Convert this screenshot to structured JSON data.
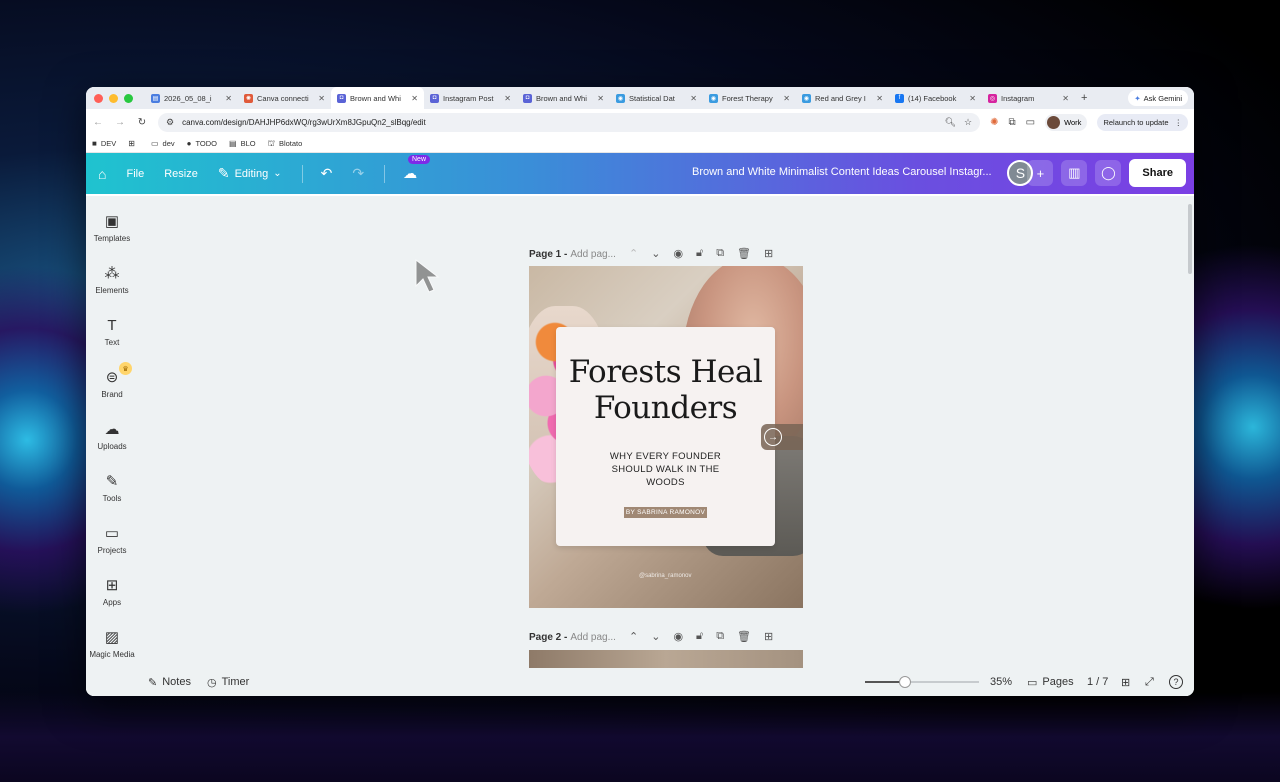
{
  "browser": {
    "tabs": [
      {
        "title": "2026_05_08_i",
        "color": "#4a7de0",
        "glyph": "▤",
        "active": false
      },
      {
        "title": "Canva connecti",
        "color": "#e05a3a",
        "glyph": "✺",
        "active": false
      },
      {
        "title": "Brown and Whi",
        "color": "#5a63d6",
        "glyph": "◘",
        "active": true
      },
      {
        "title": "Instagram Post",
        "color": "#5a63d6",
        "glyph": "◘",
        "active": false
      },
      {
        "title": "Brown and Whi",
        "color": "#5a63d6",
        "glyph": "◘",
        "active": false
      },
      {
        "title": "Statistical Dat",
        "color": "#3a9be0",
        "glyph": "◉",
        "active": false
      },
      {
        "title": "Forest Therapy",
        "color": "#3a9be0",
        "glyph": "◉",
        "active": false
      },
      {
        "title": "Red and Grey I",
        "color": "#3a9be0",
        "glyph": "◉",
        "active": false
      },
      {
        "title": "(14) Facebook",
        "color": "#1877f2",
        "glyph": "f",
        "active": false
      },
      {
        "title": "Instagram",
        "color": "#d6249f",
        "glyph": "◎",
        "active": false
      }
    ],
    "new_tab": "+",
    "ask_gemini": "Ask Gemini",
    "url": "canva.com/design/DAHJHP6dxWQ/rg3wUrXm8JGpuQn2_slBqg/edit",
    "profile": "Work",
    "relaunch": "Relaunch to update",
    "bookmarks": [
      {
        "label": "DEV",
        "icon": "■"
      },
      {
        "label": "",
        "icon": "⊞"
      },
      {
        "label": "dev",
        "icon": "▭"
      },
      {
        "label": "TODO",
        "icon": "●"
      },
      {
        "label": "BLO",
        "icon": "▤"
      },
      {
        "label": "Blotato",
        "icon": "⛫"
      }
    ]
  },
  "canva": {
    "header": {
      "file": "File",
      "resize": "Resize",
      "editing": "Editing",
      "new_badge": "New",
      "doc_title": "Brown and White Minimalist Content Ideas Carousel Instagr...",
      "avatar": "S",
      "share": "Share"
    },
    "sidebar": [
      {
        "label": "Templates",
        "icon": "▣",
        "name": "templates"
      },
      {
        "label": "Elements",
        "icon": "⁂",
        "name": "elements"
      },
      {
        "label": "Text",
        "icon": "T",
        "name": "text"
      },
      {
        "label": "Brand",
        "icon": "⊜",
        "name": "brand"
      },
      {
        "label": "Uploads",
        "icon": "☁",
        "name": "uploads"
      },
      {
        "label": "Tools",
        "icon": "✎",
        "name": "tools"
      },
      {
        "label": "Projects",
        "icon": "▭",
        "name": "projects"
      },
      {
        "label": "Apps",
        "icon": "⊞",
        "name": "apps"
      },
      {
        "label": "Magic Media",
        "icon": "▨",
        "name": "magic-media"
      }
    ],
    "pages": [
      {
        "label": "Page 1 -",
        "title_placeholder": "Add pag..."
      },
      {
        "label": "Page 2 -",
        "title_placeholder": "Add pag..."
      }
    ],
    "design": {
      "title": "Forests Heal Founders",
      "subtitle": "WHY EVERY FOUNDER SHOULD WALK IN THE WOODS",
      "byline": "BY SABRINA RAMONOV",
      "handle": "@sabrina_ramonov"
    },
    "footer": {
      "notes": "Notes",
      "timer": "Timer",
      "zoom": "35%",
      "zoom_level": 0.35,
      "pages": "Pages",
      "page_count": "1 / 7"
    }
  }
}
